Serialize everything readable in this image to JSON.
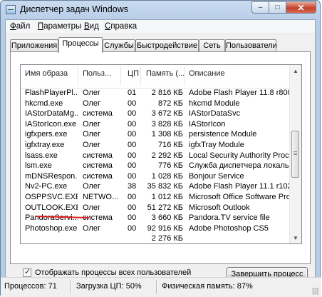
{
  "window": {
    "title": "Диспетчер задач Windows",
    "min": "–",
    "max": "□",
    "close": "✕"
  },
  "menu": [
    {
      "prefix": "",
      "accel": "Ф",
      "rest": "айл"
    },
    {
      "prefix": "",
      "accel": "П",
      "rest": "араметры"
    },
    {
      "prefix": "",
      "accel": "В",
      "rest": "ид"
    },
    {
      "prefix": "",
      "accel": "С",
      "rest": "правка"
    }
  ],
  "tabs": [
    "Приложения",
    "Процессы",
    "Службы",
    "Быстродействие",
    "Сеть",
    "Пользователи"
  ],
  "active_tab": "Процессы",
  "columns": [
    "Имя образа",
    "Польз...",
    "ЦП",
    "Память (...",
    "Описание"
  ],
  "rows": [
    [
      "FlashPlayerPl...",
      "Олег",
      "01",
      "2 816 КБ",
      "Adobe Flash Player 11.8 r800"
    ],
    [
      "hkcmd.exe",
      "Олег",
      "00",
      "872 КБ",
      "hkcmd Module"
    ],
    [
      "IAStorDataMg...",
      "система",
      "00",
      "3 672 КБ",
      "IAStorDataSvc"
    ],
    [
      "IAStorIcon.exe",
      "Олег",
      "00",
      "3 828 КБ",
      "IAStorIcon"
    ],
    [
      "igfxpers.exe",
      "Олег",
      "00",
      "1 308 КБ",
      "persistence Module"
    ],
    [
      "igfxtray.exe",
      "Олег",
      "00",
      "716 КБ",
      "igfxTray Module"
    ],
    [
      "lsass.exe",
      "система",
      "00",
      "2 292 КБ",
      "Local Security Authority Process"
    ],
    [
      "lsm.exe",
      "система",
      "00",
      "776 КБ",
      "Служба диспетчера локальных"
    ],
    [
      "mDNSRespon...",
      "система",
      "00",
      "1 028 КБ",
      "Bonjour Service"
    ],
    [
      "Nv2-PC.exe",
      "Олег",
      "38",
      "35 832 КБ",
      "Adobe Flash Player 11.1 r102"
    ],
    [
      "OSPPSVC.EXE",
      "NETWO...",
      "00",
      "1 012 КБ",
      "Microsoft Office Software Protect"
    ],
    [
      "OUTLOOK.EXE",
      "Олег",
      "00",
      "51 272 КБ",
      "Microsoft Outlook"
    ],
    [
      "PandoraServi...",
      "система",
      "00",
      "3 660 КБ",
      "Pandora.TV service file"
    ],
    [
      "Photoshop.exe",
      "Олег",
      "00",
      "92 916 КБ",
      "Adobe Photoshop CS5"
    ],
    [
      "",
      "",
      "",
      "2 276 КБ",
      ""
    ]
  ],
  "show_all_users": {
    "label": "Отображать процессы всех пользователей",
    "checked": true
  },
  "end_process_label": "Завершить процесс",
  "status": {
    "processes": "Процессов: 71",
    "cpu": "Загрузка ЦП: 50%",
    "memory": "Физическая память: 87%"
  }
}
